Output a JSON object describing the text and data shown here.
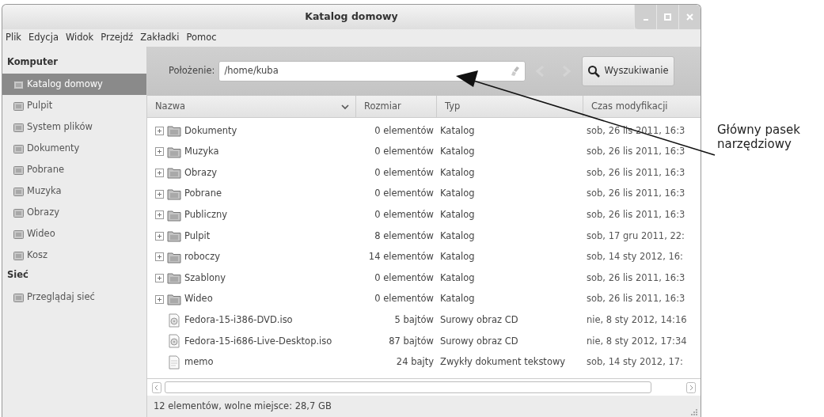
{
  "window": {
    "title": "Katalog domowy"
  },
  "menu": [
    "Plik",
    "Edycja",
    "Widok",
    "Przejdź",
    "Zakładki",
    "Pomoc"
  ],
  "sidebar": {
    "sections": [
      {
        "heading": "Komputer",
        "items": [
          {
            "label": "Katalog domowy",
            "selected": true
          },
          {
            "label": "Pulpit",
            "selected": false
          },
          {
            "label": "System plików",
            "selected": false
          },
          {
            "label": "Dokumenty",
            "selected": false
          },
          {
            "label": "Pobrane",
            "selected": false
          },
          {
            "label": "Muzyka",
            "selected": false
          },
          {
            "label": "Obrazy",
            "selected": false
          },
          {
            "label": "Wideo",
            "selected": false
          },
          {
            "label": "Kosz",
            "selected": false
          }
        ]
      },
      {
        "heading": "Sieć",
        "items": [
          {
            "label": "Przeglądaj sieć",
            "selected": false
          }
        ]
      }
    ]
  },
  "toolbar": {
    "location_label": "Położenie:",
    "location_value": "/home/kuba",
    "search_button": "Wyszukiwanie"
  },
  "table": {
    "columns": [
      {
        "label": "Nazwa",
        "sorted": true
      },
      {
        "label": "Rozmiar",
        "sorted": false
      },
      {
        "label": "Typ",
        "sorted": false
      },
      {
        "label": "Czas modyfikacji",
        "sorted": false
      }
    ],
    "rows": [
      {
        "kind": "folder",
        "expandable": true,
        "name": "Dokumenty",
        "size": "0 elementów",
        "type": "Katalog",
        "modified": "sob, 26 lis 2011, 16:3"
      },
      {
        "kind": "folder",
        "expandable": true,
        "name": "Muzyka",
        "size": "0 elementów",
        "type": "Katalog",
        "modified": "sob, 26 lis 2011, 16:3"
      },
      {
        "kind": "folder",
        "expandable": true,
        "name": "Obrazy",
        "size": "0 elementów",
        "type": "Katalog",
        "modified": "sob, 26 lis 2011, 16:3"
      },
      {
        "kind": "folder",
        "expandable": true,
        "name": "Pobrane",
        "size": "0 elementów",
        "type": "Katalog",
        "modified": "sob, 26 lis 2011, 16:3"
      },
      {
        "kind": "folder",
        "expandable": true,
        "name": "Publiczny",
        "size": "0 elementów",
        "type": "Katalog",
        "modified": "sob, 26 lis 2011, 16:3"
      },
      {
        "kind": "folder",
        "expandable": true,
        "name": "Pulpit",
        "size": "8 elementów",
        "type": "Katalog",
        "modified": "sob, 17 gru 2011, 22:"
      },
      {
        "kind": "folder",
        "expandable": true,
        "name": "roboczy",
        "size": "14 elementów",
        "type": "Katalog",
        "modified": "sob, 14 sty 2012, 16:"
      },
      {
        "kind": "folder",
        "expandable": true,
        "name": "Szablony",
        "size": "0 elementów",
        "type": "Katalog",
        "modified": "sob, 26 lis 2011, 16:3"
      },
      {
        "kind": "folder",
        "expandable": true,
        "name": "Wideo",
        "size": "0 elementów",
        "type": "Katalog",
        "modified": "sob, 26 lis 2011, 16:3"
      },
      {
        "kind": "disc",
        "expandable": false,
        "name": "Fedora-15-i386-DVD.iso",
        "size": "5 bajtów",
        "type": "Surowy obraz CD",
        "modified": "nie, 8 sty 2012, 14:16"
      },
      {
        "kind": "disc",
        "expandable": false,
        "name": "Fedora-15-i686-Live-Desktop.iso",
        "size": "87 bajtów",
        "type": "Surowy obraz CD",
        "modified": "nie, 8 sty 2012, 17:34"
      },
      {
        "kind": "text",
        "expandable": false,
        "name": "memo",
        "size": "24 bajty",
        "type": "Zwykły dokument tekstowy",
        "modified": "sob, 14 sty 2012, 17:"
      }
    ]
  },
  "status_bar": "12 elementów, wolne miejsce: 28,7 GB",
  "annotation": {
    "text": "Główny pasek narzędziowy"
  }
}
